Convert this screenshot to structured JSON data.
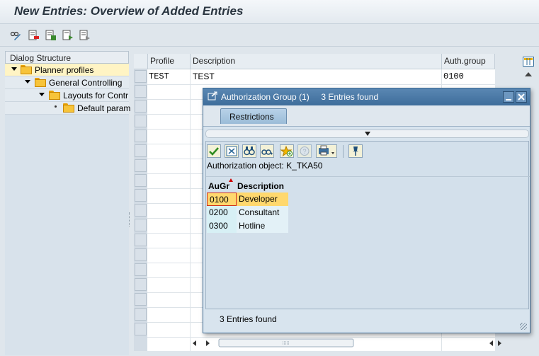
{
  "window": {
    "title": "New Entries: Overview of Added Entries"
  },
  "toolbar": {
    "icons": [
      "display-change-icon",
      "select-block-icon",
      "details-icon",
      "previous-entry-icon",
      "next-entry-icon"
    ]
  },
  "dialog_structure": {
    "header": "Dialog Structure",
    "items": [
      {
        "label": "Planner profiles",
        "level": 0,
        "selected": true,
        "expander": "arrow"
      },
      {
        "label": "General Controlling",
        "level": 1,
        "selected": false,
        "expander": "arrow"
      },
      {
        "label": "Layouts for Contr",
        "level": 2,
        "selected": false,
        "expander": "arrow"
      },
      {
        "label": "Default param",
        "level": 3,
        "selected": false,
        "expander": "dot"
      }
    ]
  },
  "table": {
    "columns": [
      "Profile",
      "Description",
      "Auth.group"
    ],
    "rows": [
      {
        "profile": "TEST",
        "description": "TEST",
        "auth_group": "0100"
      }
    ]
  },
  "dialog": {
    "title": "Authorization Group (1)",
    "entries_found_title": "3 Entries found",
    "tab": "Restrictions",
    "auth_object": "Authorization object: K_TKA50",
    "columns": [
      "AuGr",
      "Description"
    ],
    "results": [
      {
        "code": "0100",
        "description": "Developer",
        "selected": true
      },
      {
        "code": "0200",
        "description": "Consultant",
        "selected": false
      },
      {
        "code": "0300",
        "description": "Hotline",
        "selected": false
      }
    ],
    "status": "3 Entries found",
    "colors": {
      "selected_row": "#ffd86e",
      "row_bg": "#e3f1f7",
      "code_bg": "#d7f0f5"
    }
  }
}
